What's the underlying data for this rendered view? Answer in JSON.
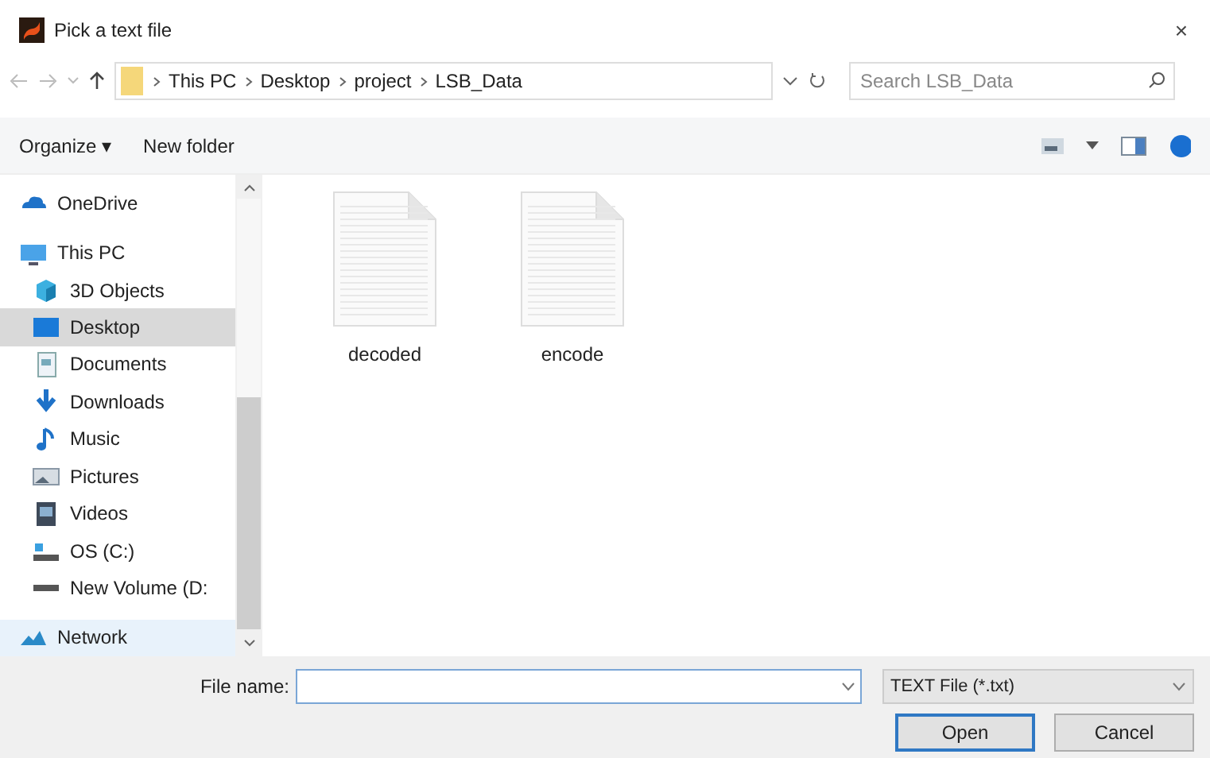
{
  "window": {
    "title": "Pick a text file",
    "close": "×"
  },
  "address_bar": {
    "path": [
      "This PC",
      "Desktop",
      "project",
      "LSB_Data"
    ]
  },
  "search": {
    "placeholder": "Search LSB_Data"
  },
  "toolbar": {
    "organize": "Organize ▾",
    "new_folder": "New folder"
  },
  "sidebar": {
    "items": [
      {
        "label": "OneDrive",
        "kind": "cloud",
        "selected": false,
        "group": true
      },
      {
        "label": "This PC",
        "kind": "pc",
        "selected": false,
        "group": true
      },
      {
        "label": "3D Objects",
        "kind": "cube",
        "selected": false,
        "group": false
      },
      {
        "label": "Desktop",
        "kind": "desktop",
        "selected": true,
        "group": false
      },
      {
        "label": "Documents",
        "kind": "document",
        "selected": false,
        "group": false
      },
      {
        "label": "Downloads",
        "kind": "download",
        "selected": false,
        "group": false
      },
      {
        "label": "Music",
        "kind": "music",
        "selected": false,
        "group": false
      },
      {
        "label": "Pictures",
        "kind": "pictures",
        "selected": false,
        "group": false
      },
      {
        "label": "Videos",
        "kind": "video",
        "selected": false,
        "group": false
      },
      {
        "label": "OS (C:)",
        "kind": "drive",
        "selected": false,
        "group": false
      },
      {
        "label": "New Volume (D:",
        "kind": "volume",
        "selected": false,
        "group": false
      },
      {
        "label": "Network",
        "kind": "network",
        "selected": false,
        "group": true
      }
    ]
  },
  "files": [
    {
      "name": "decoded"
    },
    {
      "name": "encode"
    }
  ],
  "file_name": {
    "label": "File name:"
  },
  "file_type": {
    "value": "TEXT File (*.txt)"
  },
  "buttons": [
    {
      "label": "Open",
      "default": true
    },
    {
      "label": "Cancel",
      "default": false
    }
  ]
}
